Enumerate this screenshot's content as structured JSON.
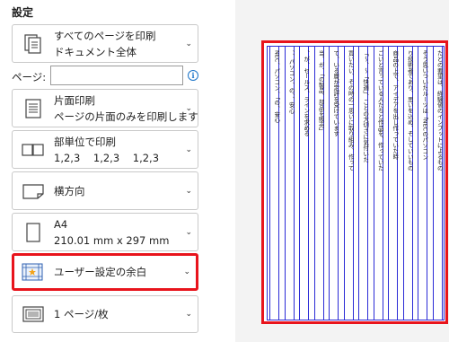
{
  "panel": {
    "title": "設定",
    "print_range": {
      "line1": "すべてのページを印刷",
      "line2": "ドキュメント全体",
      "icon": "pages-stack-icon"
    },
    "pages_field": {
      "label": "ページ:",
      "value": "",
      "placeholder": ""
    },
    "sides": {
      "line1": "片面印刷",
      "line2": "ページの片面のみを印刷します",
      "icon": "single-sided-icon"
    },
    "collate": {
      "line1": "部単位で印刷",
      "line2": "1,2,3    1,2,3    1,2,3",
      "icon": "collate-icon"
    },
    "orientation": {
      "line1": "横方向",
      "icon": "landscape-icon"
    },
    "paper": {
      "line1": "A4",
      "line2": "210.01 mm x 297 mm",
      "icon": "paper-size-icon"
    },
    "margins": {
      "line1": "ユーザー設定の余白",
      "icon": "custom-margins-icon"
    },
    "pages_per_sheet": {
      "line1": "1 ページ/枚",
      "icon": "pages-per-sheet-icon"
    }
  },
  "colors": {
    "highlight": "#e8141c",
    "margin_lines": "#2b2bd6",
    "info": "#1a73c8"
  },
  "preview": {
    "columns": [
      "たどの要望は、経験値のインプットによるもの",
      "そう思いついたルーツは「NECのパソコン",
      "り技術者であり、思いを込め、そしていいもの",
      "商品の上で、アイデアを出し作っていた時",
      "ごいと言っている人たちと作品を、作っていた",
      "「〜、〜「快適」、ことの大切さに気付いた",
      "買いたい、その時の一思いに取り組み、作って",
      "て、いる層が定評を受けています",
      "当、が、「の製品、部品を販売」",
      "、が、セールス、ラインを求める",
      "、、パソコン、の、、安心",
      "NEC、パソコン、「の、安心"
    ]
  }
}
